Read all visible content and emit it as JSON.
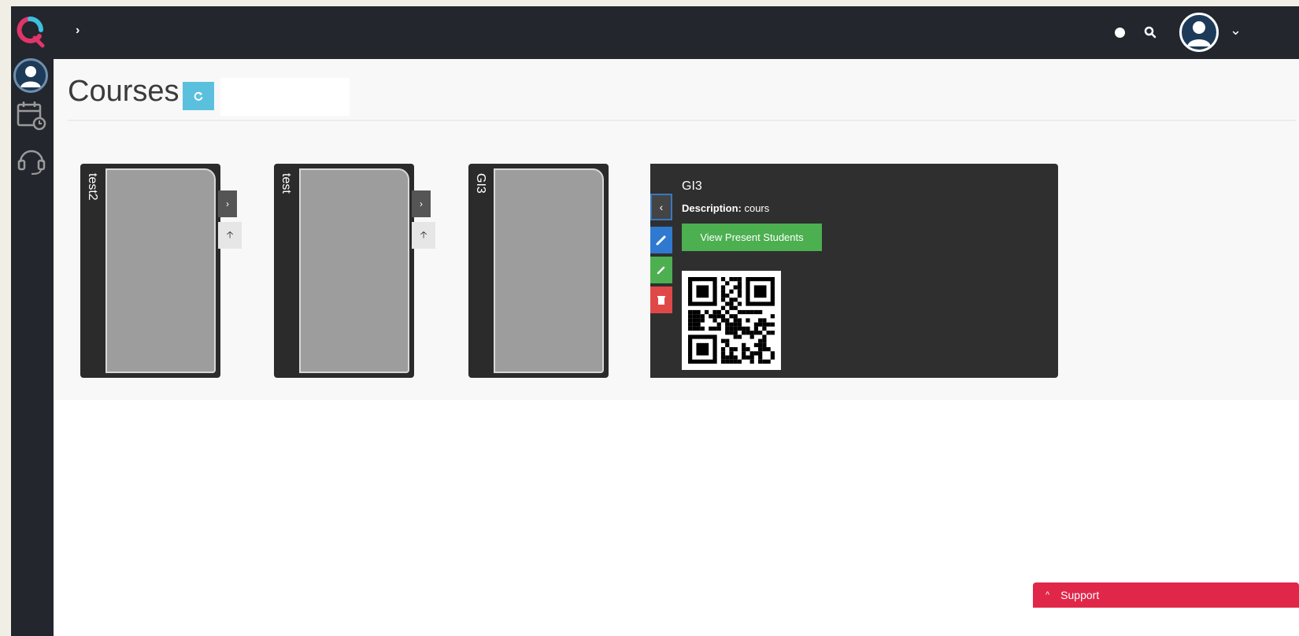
{
  "app": {
    "logo_icon": "app-logo",
    "breadcrumb_chevron": "›"
  },
  "sidebar": {
    "items": [
      {
        "icon": "user-avatar-icon"
      },
      {
        "icon": "calendar-clock-icon"
      },
      {
        "icon": "headset-icon"
      }
    ]
  },
  "topbar": {
    "status_icon": "status-dot-icon",
    "search_icon": "search-icon",
    "avatar_icon": "user-avatar-icon",
    "caret": "⌄"
  },
  "page": {
    "title": "Courses",
    "refresh_icon": "refresh-icon",
    "search_value": ""
  },
  "courses": [
    {
      "name": "test2"
    },
    {
      "name": "test"
    },
    {
      "name": "GI3"
    }
  ],
  "detail": {
    "title": "GI3",
    "description_label": "Description:",
    "description_value": "cours",
    "view_button": "View Present Students",
    "qr_icon": "qr-code"
  },
  "support": {
    "label": "Support",
    "chevron": "^"
  },
  "colors": {
    "topbar": "#23262c",
    "accent_info": "#5bc0de",
    "success": "#4caf50",
    "primary": "#2f7ad0",
    "danger": "#e04848",
    "support": "#e0274a"
  }
}
